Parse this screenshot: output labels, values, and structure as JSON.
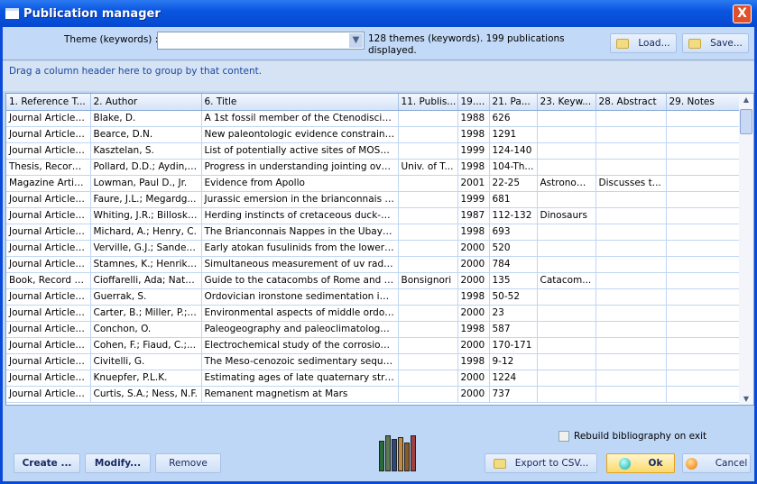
{
  "window": {
    "title": "Publication manager",
    "close": "X"
  },
  "toolbar": {
    "theme_label": "Theme (keywords) :",
    "theme_value": "",
    "info": "128 themes (keywords). 199 publications displayed.",
    "load": "Load...",
    "save": "Save..."
  },
  "group_hint": "Drag a column header here to group by that content.",
  "columns": [
    "1. Reference T...",
    "2. Author",
    "6. Title",
    "11. Publis...",
    "19....",
    "21. Pa...",
    "23. Keyw...",
    "28. Abstract",
    "29. Notes"
  ],
  "rows": [
    [
      "Journal Article, ...",
      "Blake, D.",
      "A 1st fossil member of the Ctenodiscidae ...",
      "",
      "1988",
      "626",
      "",
      "",
      ""
    ],
    [
      "Journal Article, ...",
      "Bearce, D.N.",
      "New paleontologic evidence constraining ...",
      "",
      "1998",
      "1291",
      "",
      "",
      ""
    ],
    [
      "Journal Article, ...",
      "Kasztelan, S.",
      "List of potentially active sites of MOS2(W...",
      "",
      "1999",
      "124-140",
      "",
      "",
      ""
    ],
    [
      "Thesis, Record ...",
      "Pollard, D.D.; Aydin, A.",
      "Progress in understanding jointing over t...",
      "Univ. of T...",
      "1998",
      "104-Th...",
      "",
      "",
      ""
    ],
    [
      "Magazine Articl...",
      "Lowman, Paul D., Jr.",
      "Evidence from Apollo",
      "",
      "2001",
      "22-25",
      "Astronom...",
      "Discusses t...",
      ""
    ],
    [
      "Journal Article, ...",
      "Faure, J.L.; Megardg...",
      "Jurassic emersion in the brianconnais zon...",
      "",
      "1999",
      "681",
      "",
      "",
      ""
    ],
    [
      "Journal Article, ...",
      "Whiting, J.R.; Billoski...",
      "Herding instincts of cretaceous duck-bille...",
      "",
      "1987",
      "112-132",
      "Dinosaurs",
      "",
      ""
    ],
    [
      "Journal Article, ...",
      "Michard, A.; Henry, C.",
      "The Brianconnais Nappes in the Ubaye Va...",
      "",
      "1998",
      "693",
      "",
      "",
      ""
    ],
    [
      "Journal Article, ...",
      "Verville, G.J.; Sander...",
      "Early atokan fusulinids from the lower Ant...",
      "",
      "2000",
      "520",
      "",
      "",
      ""
    ],
    [
      "Journal Article, ...",
      "Stamnes, K.; Henriks...",
      "Simultaneous measurement of uv radiatio...",
      "",
      "2000",
      "784",
      "",
      "",
      ""
    ],
    [
      "Book, Record N...",
      "Cioffarelli, Ada; Natal...",
      "Guide to the catacombs of Rome and its s...",
      "Bonsignori",
      "2000",
      "135",
      "Catacom...",
      "",
      ""
    ],
    [
      "Journal Article, ...",
      "Guerrak, S.",
      "Ordovician ironstone sedimentation in Ou...",
      "",
      "1998",
      "50-52",
      "",
      "",
      ""
    ],
    [
      "Journal Article, ...",
      "Carter, B.; Miller, P.; ...",
      "Environmental aspects of middle ordovicia...",
      "",
      "2000",
      "23",
      "",
      "",
      ""
    ],
    [
      "Journal Article, ...",
      "Conchon, O.",
      "Paleogeography and paleoclimatology of ...",
      "",
      "1998",
      "587",
      "",
      "",
      ""
    ],
    [
      "Journal Article, ...",
      "Cohen, F.; Fiaud, C.;...",
      "Electrochemical study of the corrosion of ...",
      "",
      "2000",
      "170-171",
      "",
      "",
      ""
    ],
    [
      "Journal Article, ...",
      "Civitelli, G.",
      "The Meso-cenozoic sedimentary sequenc...",
      "",
      "1998",
      "9-12",
      "",
      "",
      ""
    ],
    [
      "Journal Article, ...",
      "Knuepfer, P.L.K.",
      "Estimating ages of late quaternary strea...",
      "",
      "2000",
      "1224",
      "",
      "",
      ""
    ],
    [
      "Journal Article, ...",
      "Curtis, S.A.; Ness, N.F.",
      "Remanent magnetism at Mars",
      "",
      "2000",
      "737",
      "",
      "",
      ""
    ]
  ],
  "footer": {
    "rebuild_label": "Rebuild bibliography on exit",
    "rebuild_checked": false,
    "create": "Create ...",
    "modify": "Modify...",
    "remove": "Remove",
    "export": "Export to CSV...",
    "ok": "Ok",
    "cancel": "Cancel"
  }
}
